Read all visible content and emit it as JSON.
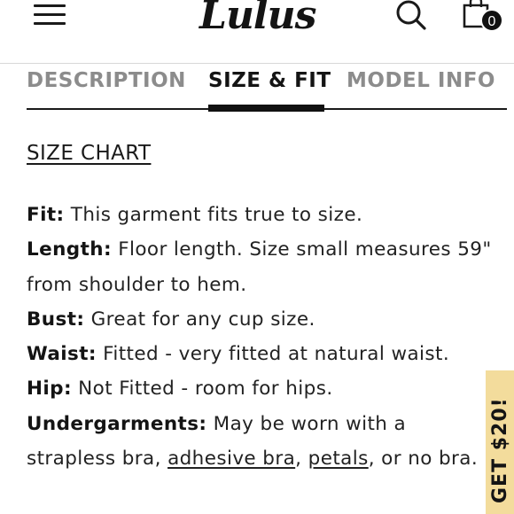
{
  "header": {
    "logo_text": "Lulus",
    "cart_count": "0",
    "icons": {
      "menu": "hamburger-menu-icon",
      "search": "search-icon",
      "bag": "shopping-bag-icon"
    }
  },
  "tabs": [
    {
      "label": "DESCRIPTION",
      "active": false
    },
    {
      "label": "SIZE & FIT",
      "active": true
    },
    {
      "label": "MODEL INFO",
      "active": false
    }
  ],
  "size_chart_link": "SIZE CHART",
  "details": {
    "fit": {
      "label": "Fit:",
      "text": " This garment fits true to size."
    },
    "length": {
      "label": "Length:",
      "text": " Floor length. Size small measures 59\" from shoulder to hem."
    },
    "bust": {
      "label": "Bust:",
      "text": " Great for any cup size."
    },
    "waist": {
      "label": "Waist:",
      "text": " Fitted - very fitted at natural waist."
    },
    "hip": {
      "label": "Hip:",
      "text": " Not Fitted - room for hips."
    },
    "undergarments": {
      "label": "Undergarments:",
      "text_1": " May be worn with a strapless bra, ",
      "link_1": "adhesive bra",
      "text_2": ", ",
      "link_2": "petals",
      "text_3": ", or no bra."
    }
  },
  "promo": {
    "label": "GET $20!"
  },
  "colors": {
    "accent": "#111111",
    "inactive_tab": "#8c8c8c",
    "promo_bg": "#f3dc9c"
  }
}
